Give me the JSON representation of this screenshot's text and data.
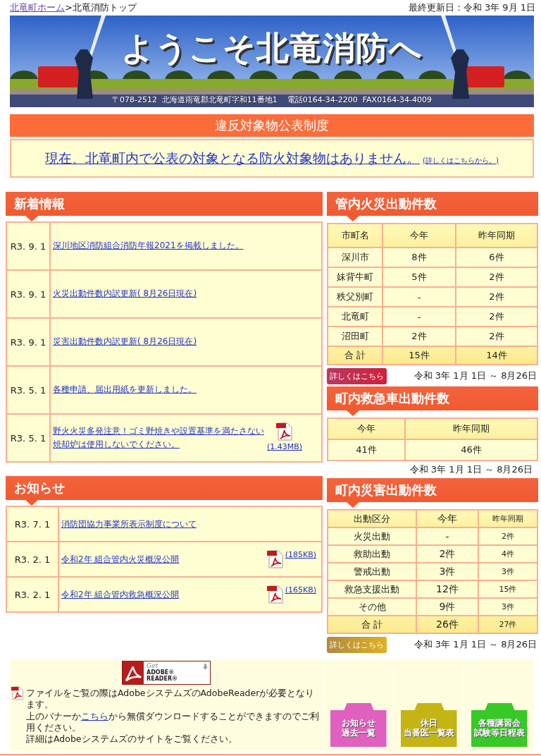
{
  "breadcrumb": {
    "home_link": "北竜町ホーム",
    "separator": ">",
    "current": "北竜消防トップ"
  },
  "last_updated": "最終更新日：令和 3年 9月 1日",
  "banner": {
    "title": "ようこそ北竜消防へ",
    "address": "〒078-2512  北海道雨竜郡北竜町字和11番地1    電話0164-34-2200  FAX0164-34-4009"
  },
  "violation": {
    "heading": "違反対象物公表制度",
    "message": "現在、北竜町内で公表の対象となる防火対象物はありません。",
    "details_link": "(詳しくはこちらから。)"
  },
  "news": {
    "heading": "新着情報",
    "items": [
      {
        "date": "R3. 9. 1",
        "title": "深川地区消防組合消防年報2021を掲載しました。"
      },
      {
        "date": "R3. 9. 1",
        "title": "火災出動件数内訳更新( 8月26日現在)"
      },
      {
        "date": "R3. 9. 1",
        "title": "災害出動件数内訳更新( 8月26日現在)"
      },
      {
        "date": "R3. 5. 1",
        "title": "各種申請、届出用紙を更新しました。"
      },
      {
        "date": "R3. 5. 1",
        "title": "野火火災多発注意！ゴミ野焼きや設置基準を満たさない焼却炉は使用しないでください。",
        "attachment": "(1.43MB)"
      }
    ]
  },
  "notices": {
    "heading": "お知らせ",
    "items": [
      {
        "date": "R3. 7. 1",
        "title": "消防団協力事業所表示制度について"
      },
      {
        "date": "R3. 2. 1",
        "title": "令和2年 組合管内火災概況公開",
        "attachment": "(185KB)"
      },
      {
        "date": "R3. 2. 1",
        "title": "令和2年 組合管内救急概況公開",
        "attachment": "(165KB)"
      }
    ]
  },
  "fire_dispatch": {
    "heading": "管内火災出動件数",
    "columns": [
      "市町名",
      "今年",
      "昨年同期"
    ],
    "rows": [
      [
        "深川市",
        "8件",
        "6件"
      ],
      [
        "妹背牛町",
        "5件",
        "2件"
      ],
      [
        "秩父別町",
        "-",
        "2件"
      ],
      [
        "北竜町",
        "-",
        "2件"
      ],
      [
        "沼田町",
        "2件",
        "2件"
      ]
    ],
    "total": [
      "合 計",
      "15件",
      "14件"
    ],
    "details_button": {
      "label": "詳しくはこちら",
      "kind": "crimson"
    },
    "period": "令和 3年 1月 1日 ～ 8月26日"
  },
  "ambulance_dispatch": {
    "heading": "町内救急車出動件数",
    "columns": [
      "今年",
      "昨年同期"
    ],
    "rows": [
      [
        "41件",
        "46件"
      ]
    ],
    "period": "令和 3年 1月 1日 ～ 8月26日"
  },
  "disaster_dispatch": {
    "heading": "町内災害出動件数",
    "columns": [
      "出動区分",
      "今年",
      "昨年同期"
    ],
    "rows": [
      [
        "火災出動",
        "-",
        "2件"
      ],
      [
        "救助出動",
        "2件",
        "4件"
      ],
      [
        "警戒出動",
        "3件",
        "3件"
      ],
      [
        "救急支援出動",
        "12件",
        "15件"
      ],
      [
        "その他",
        "9件",
        "3件"
      ]
    ],
    "total": [
      "合 計",
      "26件",
      "27件"
    ],
    "details_button": {
      "label": "詳しくはこちら",
      "kind": "gold"
    },
    "period": "令和 3年 1月 1日 ～ 8月26日"
  },
  "footer": {
    "adobe_badge": {
      "get": "Get",
      "product": "ADOBE® READER®"
    },
    "notice": {
      "line_1": "ファイルをご覧の際はAdobeシステムズのAdobeReaderが必要となります。",
      "line_2_before": "上のバナーか",
      "line_2_link": "こちら",
      "line_2_after": "から無償ダウンロードすることができますのでご利用ください。",
      "line_3": "詳細はAdobeシステムズのサイトをご覧ください。"
    },
    "banners": [
      {
        "lines": [
          "お知らせ",
          "過去一覧"
        ],
        "color": "#e060c0"
      },
      {
        "lines": [
          "休日",
          "当番医一覧表"
        ],
        "color": "#c4b414"
      },
      {
        "lines": [
          "各種講習会",
          "試験等日程表"
        ],
        "color": "#38c828"
      }
    ]
  }
}
